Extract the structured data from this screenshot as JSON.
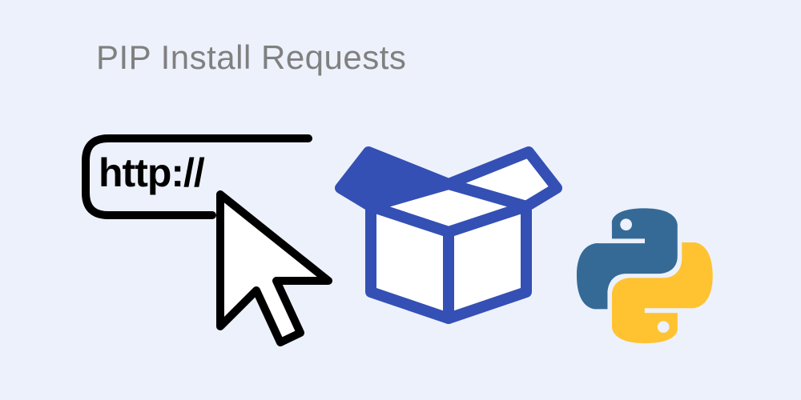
{
  "title": "PIP Install Requests",
  "http_label": "http://",
  "colors": {
    "background": "#edf1fb",
    "title": "#808080",
    "box_blue": "#3450b4",
    "python_blue": "#366a96",
    "python_yellow": "#ffc331"
  }
}
